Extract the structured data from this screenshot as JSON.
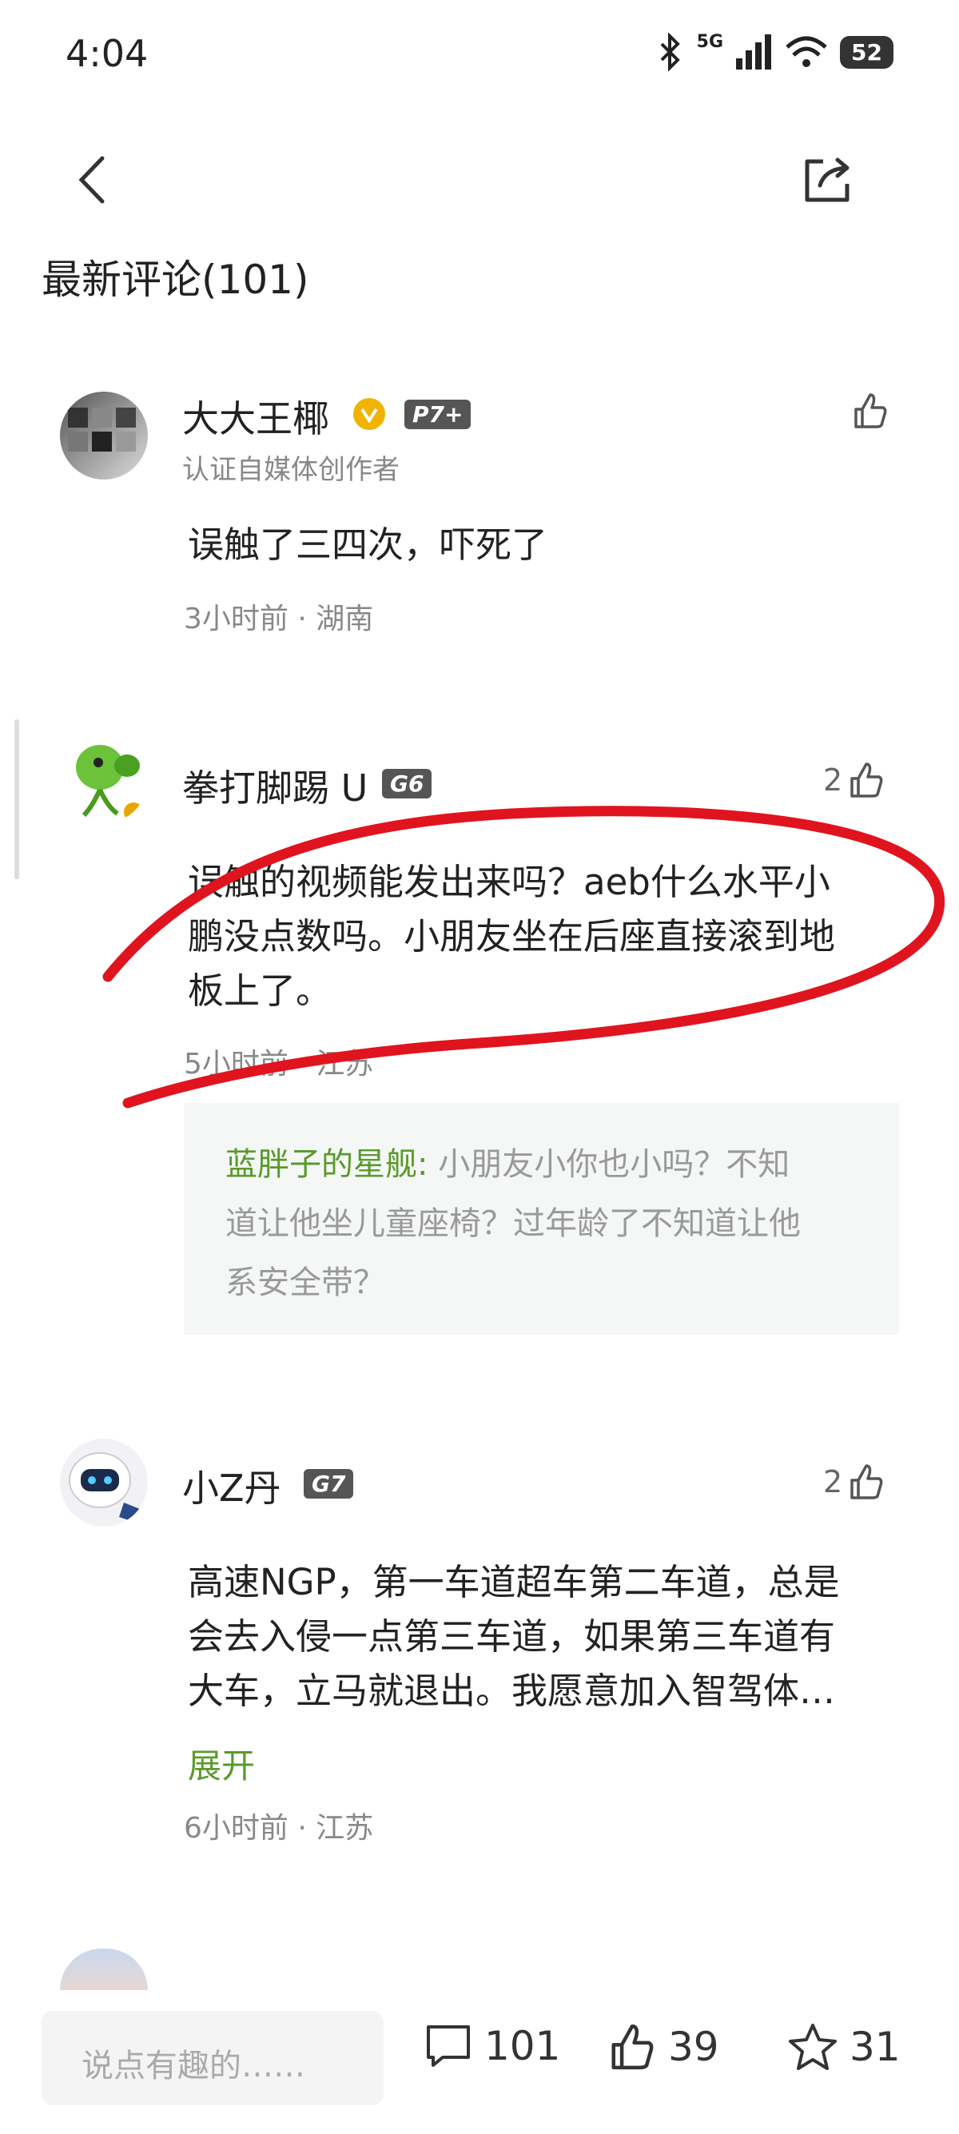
{
  "status_bar": {
    "time": "4:04",
    "network": "5G",
    "battery": "52"
  },
  "header": {
    "section_title": "最新评论(101)"
  },
  "comments": [
    {
      "username": "大大王椰",
      "level": "P7+",
      "subtitle": "认证自媒体创作者",
      "text_lines": [
        "误触了三四次，吓死了"
      ],
      "meta": "3小时前 · 湖南",
      "likes": ""
    },
    {
      "username": "拳打脚踢 U",
      "level": "G6",
      "text_lines": [
        "误触的视频能发出来吗？aeb什么水平小",
        "鹏没点数吗。小朋友坐在后座直接滚到地",
        "板上了。"
      ],
      "meta": "5小时前 · 江苏",
      "likes": "2",
      "reply": {
        "name": "蓝胖子的星舰:",
        "lines": [
          " 小朋友小你也小吗？不知",
          "道让他坐儿童座椅？过年龄了不知道让他",
          "系安全带？"
        ]
      }
    },
    {
      "username": "小Z丹",
      "level": "G7",
      "text_lines": [
        "高速NGP，第一车道超车第二车道，总是",
        "会去入侵一点第三车道，如果第三车道有",
        "大车，立马就退出。我愿意加入智驾体…"
      ],
      "expand": "展开",
      "meta": "6小时前 · 江苏",
      "likes": "2"
    }
  ],
  "bottom_bar": {
    "input_placeholder": "说点有趣的……",
    "comment_count": "101",
    "like_count": "39",
    "fav_count": "31"
  }
}
